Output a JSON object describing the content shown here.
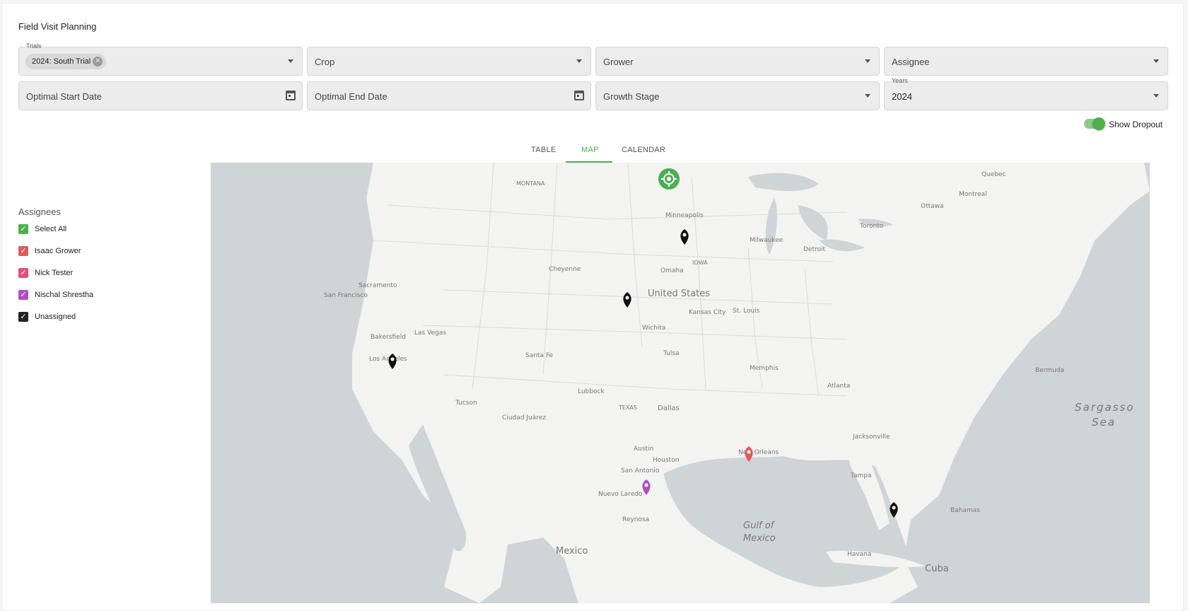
{
  "page": {
    "title": "Field Visit Planning"
  },
  "filters": {
    "trials": {
      "label": "Trials",
      "chip": "2024: South Trial"
    },
    "crop": {
      "placeholder": "Crop"
    },
    "grower": {
      "placeholder": "Grower"
    },
    "assignee": {
      "placeholder": "Assignee"
    },
    "optimal_start": {
      "placeholder": "Optimal Start Date"
    },
    "optimal_end": {
      "placeholder": "Optimal End Date"
    },
    "growth_stage": {
      "placeholder": "Growth Stage"
    },
    "years": {
      "label": "Years",
      "value": "2024"
    }
  },
  "toggle": {
    "label": "Show Dropout",
    "on": true
  },
  "tabs": [
    {
      "label": "TABLE",
      "active": false
    },
    {
      "label": "MAP",
      "active": true
    },
    {
      "label": "CALENDAR",
      "active": false
    }
  ],
  "legend": {
    "title": "Assignees",
    "items": [
      {
        "label": "Select All",
        "color": "#4caf50",
        "checked": true
      },
      {
        "label": "Isaac Grower",
        "color": "#e05a5a",
        "checked": true
      },
      {
        "label": "Nick Tester",
        "color": "#e0507a",
        "checked": true
      },
      {
        "label": "Nischal Shrestha",
        "color": "#b04ec0",
        "checked": true
      },
      {
        "label": "Unassigned",
        "color": "#222222",
        "checked": true
      }
    ]
  },
  "map": {
    "labels": {
      "country_us": "United States",
      "country_mx": "Mexico",
      "gulf1": "Gulf of",
      "gulf2": "Mexico",
      "cuba": "Cuba",
      "sargasso1": "Sargasso",
      "sargasso2": "Sea",
      "bermuda": "Bermuda",
      "bahamas": "Bahamas",
      "montana": "MONTANA",
      "texas": "TEXAS",
      "iowa": "IOWA",
      "minneapolis": "Minneapolis",
      "omaha": "Omaha",
      "kansas_city": "Kansas City",
      "wichita": "Wichita",
      "dallas": "Dallas",
      "houston": "Houston",
      "austin": "Austin",
      "san_antonio": "San Antonio",
      "los_angeles": "Los Angeles",
      "san_francisco": "San Francisco",
      "las_vegas": "Las Vegas",
      "denver": "Cheyenne",
      "chicago": "Milwaukee",
      "detroit": "Detroit",
      "toronto": "Toronto",
      "montreal": "Montreal",
      "new_orleans": "New Orleans",
      "memphis": "Memphis",
      "atlanta": "Atlanta",
      "jacksonville": "Jacksonville",
      "tampa": "Tampa",
      "st_louis": "St. Louis",
      "tulsa": "Tulsa",
      "santa_fe": "Santa Fe",
      "tucson": "Tucson",
      "ciudad_juarez": "Ciudad Juárez",
      "lubbock": "Lubbock",
      "havana": "Havana",
      "nuevo_laredo": "Nuevo Laredo",
      "reynosa": "Reynosa",
      "sacramento": "Sacramento",
      "bakersfield": "Bakersfield",
      "quebec": "Quebec",
      "ottawa": "Ottawa"
    }
  }
}
